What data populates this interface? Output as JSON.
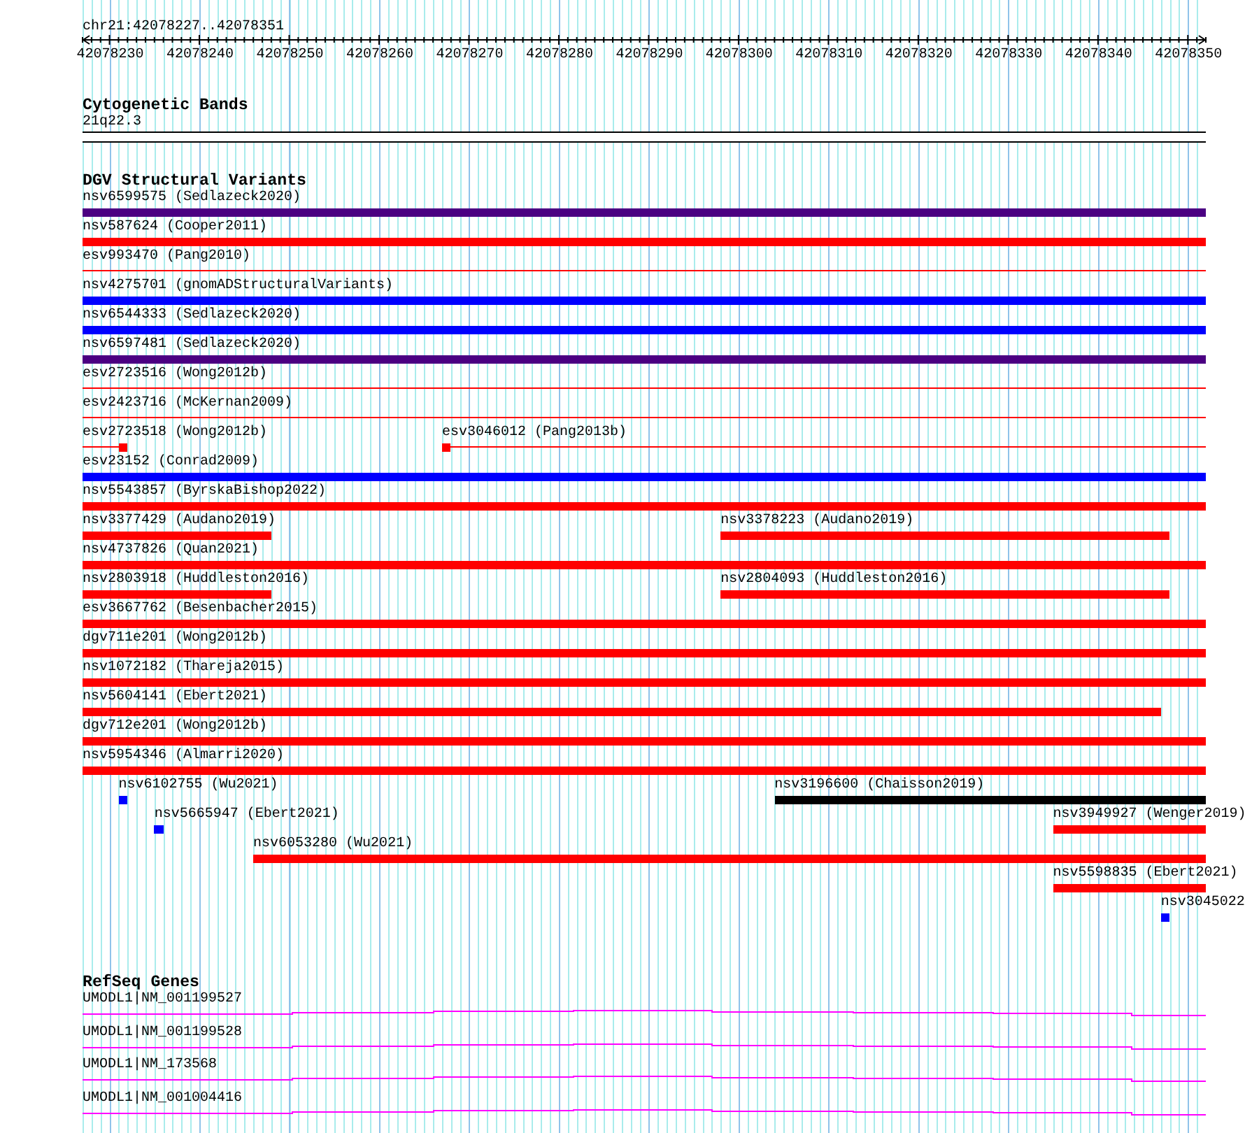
{
  "ruler": {
    "title": "chr21:42078227..42078351",
    "ticks": [
      "42078230",
      "42078240",
      "42078250",
      "42078260",
      "42078270",
      "42078280",
      "42078290",
      "42078300",
      "42078310",
      "42078320",
      "42078330",
      "42078340",
      "42078350"
    ]
  },
  "cytogenetic_bands": {
    "heading": "Cytogenetic Bands",
    "bands": [
      {
        "label": "21q22.3"
      }
    ]
  },
  "dgv_structural_variants": {
    "heading": "DGV Structural Variants",
    "rows": [
      [
        {
          "label": "nsv6599575 (Sedlazeck2020)",
          "kind": "bar",
          "color": "#4b0082"
        }
      ],
      [
        {
          "label": "nsv587624 (Cooper2011)",
          "kind": "bar",
          "color": "#ff0000"
        }
      ],
      [
        {
          "label": "esv993470 (Pang2010)",
          "kind": "line",
          "color": "#ff0000"
        }
      ],
      [
        {
          "label": "nsv4275701 (gnomADStructuralVariants)",
          "kind": "bar",
          "color": "#0000ff"
        }
      ],
      [
        {
          "label": "nsv6544333 (Sedlazeck2020)",
          "kind": "bar",
          "color": "#0000ff"
        }
      ],
      [
        {
          "label": "nsv6597481 (Sedlazeck2020)",
          "kind": "bar",
          "color": "#4b0082"
        }
      ],
      [
        {
          "label": "esv2723516 (Wong2012b)",
          "kind": "line",
          "color": "#ff0000"
        }
      ],
      [
        {
          "label": "esv2423716 (McKernan2009)",
          "kind": "line",
          "color": "#ff0000"
        }
      ],
      [
        {
          "label": "esv2723518 (Wong2012b)",
          "kind": "line-block",
          "color": "#ff0000"
        },
        {
          "label": "esv3046012 (Pang2013b)",
          "kind": "line-block",
          "color": "#ff0000"
        }
      ],
      [
        {
          "label": "esv23152 (Conrad2009)",
          "kind": "bar",
          "color": "#0000ff"
        }
      ],
      [
        {
          "label": "nsv5543857 (ByrskaBishop2022)",
          "kind": "bar",
          "color": "#ff0000"
        }
      ],
      [
        {
          "label": "nsv3377429 (Audano2019)",
          "kind": "bar",
          "color": "#ff0000"
        },
        {
          "label": "nsv3378223 (Audano2019)",
          "kind": "bar",
          "color": "#ff0000"
        }
      ],
      [
        {
          "label": "nsv4737826 (Quan2021)",
          "kind": "bar",
          "color": "#ff0000"
        }
      ],
      [
        {
          "label": "nsv2803918 (Huddleston2016)",
          "kind": "bar",
          "color": "#ff0000"
        },
        {
          "label": "nsv2804093 (Huddleston2016)",
          "kind": "bar",
          "color": "#ff0000"
        }
      ],
      [
        {
          "label": "esv3667762 (Besenbacher2015)",
          "kind": "bar",
          "color": "#ff0000"
        }
      ],
      [
        {
          "label": "dgv711e201 (Wong2012b)",
          "kind": "bar",
          "color": "#ff0000"
        }
      ],
      [
        {
          "label": "nsv1072182 (Thareja2015)",
          "kind": "bar",
          "color": "#ff0000"
        }
      ],
      [
        {
          "label": "nsv5604141 (Ebert2021)",
          "kind": "bar",
          "color": "#ff0000"
        }
      ],
      [
        {
          "label": "dgv712e201 (Wong2012b)",
          "kind": "bar",
          "color": "#ff0000"
        }
      ],
      [
        {
          "label": "nsv5954346 (Almarri2020)",
          "kind": "bar",
          "color": "#ff0000"
        }
      ],
      [
        {
          "label": "nsv6102755 (Wu2021)",
          "kind": "bar",
          "color": "#0000ff"
        },
        {
          "label": "nsv3196600 (Chaisson2019)",
          "kind": "bar",
          "color": "#000000"
        }
      ],
      [
        {
          "label": "nsv5665947 (Ebert2021)",
          "kind": "bar",
          "color": "#0000ff"
        },
        {
          "label": "nsv3949927 (Wenger2019)",
          "kind": "bar",
          "color": "#ff0000"
        }
      ],
      [
        {
          "label": "nsv6053280 (Wu2021)",
          "kind": "bar",
          "color": "#ff0000"
        }
      ],
      [
        {
          "label": "nsv5598835 (Ebert2021)",
          "kind": "bar",
          "color": "#ff0000"
        }
      ],
      [
        {
          "label": "nsv3045022",
          "kind": "bar",
          "color": "#0000ff"
        }
      ]
    ]
  },
  "refseq_genes": {
    "heading": "RefSeq Genes",
    "transcripts": [
      {
        "label": "UMODL1|NM_001199527"
      },
      {
        "label": "UMODL1|NM_001199528"
      },
      {
        "label": "UMODL1|NM_173568"
      },
      {
        "label": "UMODL1|NM_001004416"
      }
    ]
  }
}
